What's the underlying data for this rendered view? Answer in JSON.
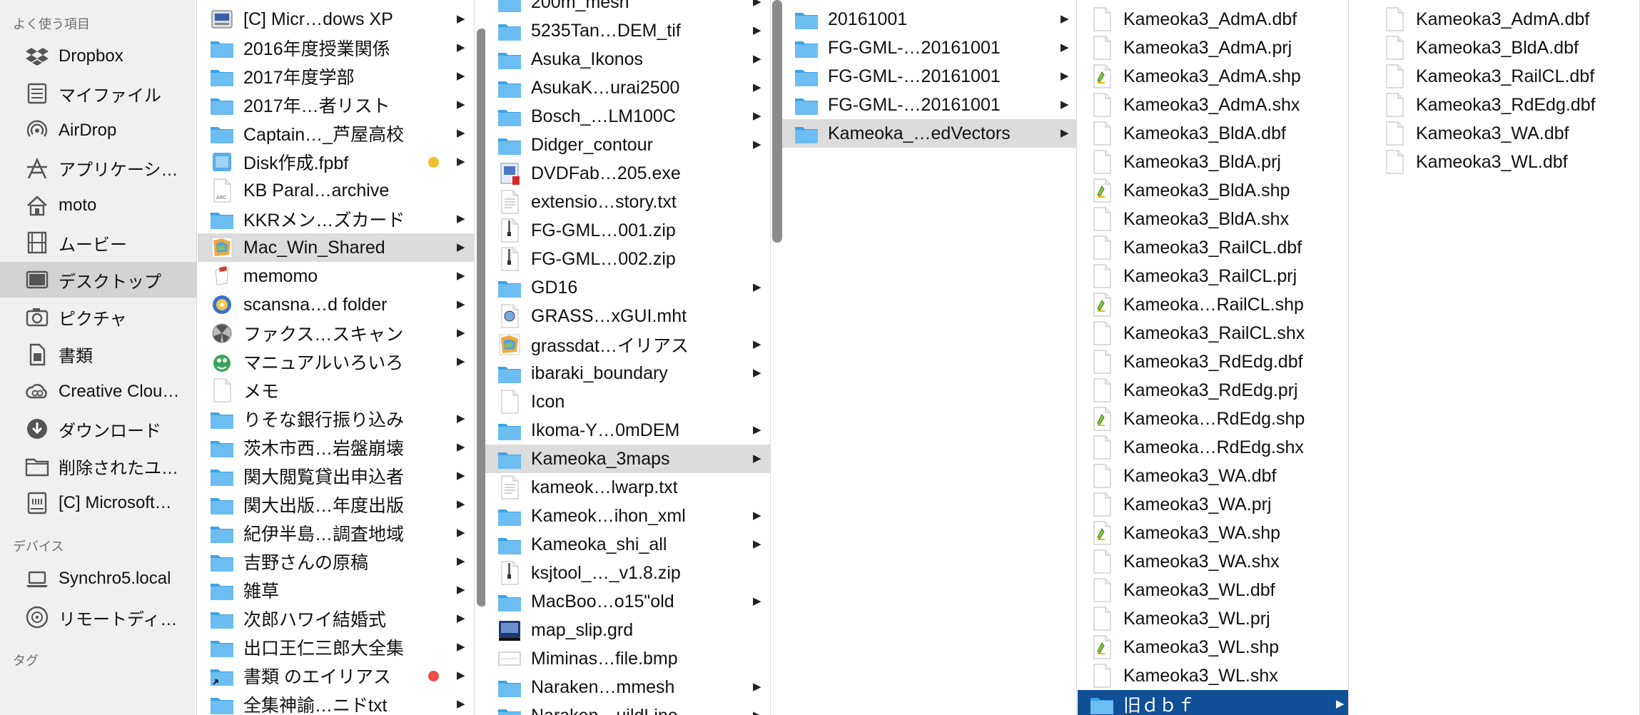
{
  "colors": {
    "folder": "#6cbdf2",
    "folder_dark": "#3ea2e6",
    "selection_active": "#114f96",
    "selection_inactive": "#dcdcdc",
    "tag_yellow": "#f2bf2d",
    "tag_red": "#ef4c46"
  },
  "sidebar": {
    "favorites_header": "よく使う項目",
    "favorites": [
      {
        "label": "Dropbox",
        "icon": "dropbox-icon"
      },
      {
        "label": "マイファイル",
        "icon": "all-my-files-icon"
      },
      {
        "label": "AirDrop",
        "icon": "airdrop-icon"
      },
      {
        "label": "アプリケーシ…",
        "icon": "applications-icon"
      },
      {
        "label": "moto",
        "icon": "home-icon"
      },
      {
        "label": "ムービー",
        "icon": "movies-icon"
      },
      {
        "label": "デスクトップ",
        "icon": "desktop-icon",
        "selected": true
      },
      {
        "label": "ピクチャ",
        "icon": "pictures-icon"
      },
      {
        "label": "書類",
        "icon": "documents-icon"
      },
      {
        "label": "Creative Clou…",
        "icon": "creative-cloud-icon"
      },
      {
        "label": "ダウンロード",
        "icon": "downloads-icon"
      },
      {
        "label": "削除されたユ…",
        "icon": "folder-icon"
      },
      {
        "label": "[C] Microsoft…",
        "icon": "drive-icon"
      }
    ],
    "devices_header": "デバイス",
    "devices": [
      {
        "label": "Synchro5.local",
        "icon": "laptop-icon"
      },
      {
        "label": "リモートディ…",
        "icon": "disc-icon"
      }
    ],
    "tags_header": "タグ"
  },
  "columns": [
    {
      "items": [
        {
          "name": "[C] Micr…dows XP",
          "icon": "drive",
          "arrow": true
        },
        {
          "name": "2016年度授業関係",
          "icon": "folder",
          "arrow": true
        },
        {
          "name": "2017年度学部",
          "icon": "folder",
          "arrow": true
        },
        {
          "name": "2017年…者リスト",
          "icon": "folder",
          "arrow": true
        },
        {
          "name": "Captain…_芦屋高校",
          "icon": "folder",
          "arrow": true
        },
        {
          "name": "Disk作成.fpbf",
          "icon": "bundle",
          "arrow": true,
          "tag": "yellow"
        },
        {
          "name": "KB Paral…archive",
          "icon": "archive",
          "arrow": false
        },
        {
          "name": "KKRメン…ズカード",
          "icon": "folder",
          "arrow": true
        },
        {
          "name": "Mac_Win_Shared",
          "icon": "alias",
          "arrow": true,
          "highlight": true
        },
        {
          "name": "memomo",
          "icon": "app",
          "arrow": true
        },
        {
          "name": "scansna…d folder",
          "icon": "app2",
          "arrow": true
        },
        {
          "name": "ファクス…スキャン",
          "icon": "app3",
          "arrow": true
        },
        {
          "name": "マニュアルいろいろ",
          "icon": "app4",
          "arrow": true
        },
        {
          "name": "メモ",
          "icon": "doc",
          "arrow": false
        },
        {
          "name": "りそな銀行振り込み",
          "icon": "folder",
          "arrow": true
        },
        {
          "name": "茨木市西…岩盤崩壊",
          "icon": "folder",
          "arrow": true
        },
        {
          "name": "関大閲覧貸出申込者",
          "icon": "folder",
          "arrow": true
        },
        {
          "name": "関大出版…年度出版",
          "icon": "folder",
          "arrow": true
        },
        {
          "name": "紀伊半島…調査地域",
          "icon": "folder",
          "arrow": true
        },
        {
          "name": "吉野さんの原稿",
          "icon": "folder",
          "arrow": true
        },
        {
          "name": "雑草",
          "icon": "folder",
          "arrow": true
        },
        {
          "name": "次郎ハワイ結婚式",
          "icon": "folder",
          "arrow": true
        },
        {
          "name": "出口王仁三郎大全集",
          "icon": "folder",
          "arrow": true
        },
        {
          "name": "書類 のエイリアス",
          "icon": "folder-alias",
          "arrow": true,
          "tag": "red"
        },
        {
          "name": "全集神諭…ニドtxt",
          "icon": "folder",
          "arrow": true
        }
      ]
    },
    {
      "items": [
        {
          "name": "200m_mesh",
          "icon": "folder",
          "arrow": true
        },
        {
          "name": "5235Tan…DEM_tif",
          "icon": "folder",
          "arrow": true
        },
        {
          "name": "Asuka_Ikonos",
          "icon": "folder",
          "arrow": true
        },
        {
          "name": "AsukaK…urai2500",
          "icon": "folder",
          "arrow": true
        },
        {
          "name": "Bosch_…LM100C",
          "icon": "folder",
          "arrow": true
        },
        {
          "name": "Didger_contour",
          "icon": "folder",
          "arrow": true
        },
        {
          "name": "DVDFab…205.exe",
          "icon": "exe",
          "arrow": false
        },
        {
          "name": "extensio…story.txt",
          "icon": "txt",
          "arrow": false
        },
        {
          "name": "FG-GML…001.zip",
          "icon": "zip",
          "arrow": false
        },
        {
          "name": "FG-GML…002.zip",
          "icon": "zip",
          "arrow": false
        },
        {
          "name": "GD16",
          "icon": "folder",
          "arrow": true
        },
        {
          "name": "GRASS…xGUI.mht",
          "icon": "mht",
          "arrow": false
        },
        {
          "name": "grassdat…イリアス",
          "icon": "alias",
          "arrow": true
        },
        {
          "name": "ibaraki_boundary",
          "icon": "folder",
          "arrow": true
        },
        {
          "name": "Icon",
          "icon": "doc",
          "arrow": false
        },
        {
          "name": "Ikoma-Y…0mDEM",
          "icon": "folder",
          "arrow": true
        },
        {
          "name": "Kameoka_3maps",
          "icon": "folder",
          "arrow": true,
          "highlight": true
        },
        {
          "name": "kameok…lwarp.txt",
          "icon": "txt",
          "arrow": false
        },
        {
          "name": "Kameok…ihon_xml",
          "icon": "folder",
          "arrow": true
        },
        {
          "name": "Kameoka_shi_all",
          "icon": "folder",
          "arrow": true
        },
        {
          "name": "ksjtool_…_v1.8.zip",
          "icon": "zip",
          "arrow": false
        },
        {
          "name": "MacBoo…o15\"old",
          "icon": "folder",
          "arrow": true
        },
        {
          "name": "map_slip.grd",
          "icon": "grd",
          "arrow": false
        },
        {
          "name": "Miminas…file.bmp",
          "icon": "bmp",
          "arrow": false
        },
        {
          "name": "Naraken…mmesh",
          "icon": "folder",
          "arrow": true
        },
        {
          "name": "Naraken…uildLine",
          "icon": "folder",
          "arrow": true
        }
      ]
    },
    {
      "items": [
        {
          "name": "20161001",
          "icon": "folder",
          "arrow": true
        },
        {
          "name": "FG-GML-…20161001",
          "icon": "folder",
          "arrow": true
        },
        {
          "name": "FG-GML-…20161001",
          "icon": "folder",
          "arrow": true
        },
        {
          "name": "FG-GML-…20161001",
          "icon": "folder",
          "arrow": true
        },
        {
          "name": "Kameoka_…edVectors",
          "icon": "folder",
          "arrow": true,
          "highlight": true
        }
      ]
    },
    {
      "items": [
        {
          "name": "Kameoka3_AdmA.dbf",
          "icon": "doc",
          "arrow": false
        },
        {
          "name": "Kameoka3_AdmA.prj",
          "icon": "doc",
          "arrow": false
        },
        {
          "name": "Kameoka3_AdmA.shp",
          "icon": "shp",
          "arrow": false
        },
        {
          "name": "Kameoka3_AdmA.shx",
          "icon": "doc",
          "arrow": false
        },
        {
          "name": "Kameoka3_BldA.dbf",
          "icon": "doc",
          "arrow": false
        },
        {
          "name": "Kameoka3_BldA.prj",
          "icon": "doc",
          "arrow": false
        },
        {
          "name": "Kameoka3_BldA.shp",
          "icon": "shp",
          "arrow": false
        },
        {
          "name": "Kameoka3_BldA.shx",
          "icon": "doc",
          "arrow": false
        },
        {
          "name": "Kameoka3_RailCL.dbf",
          "icon": "doc",
          "arrow": false
        },
        {
          "name": "Kameoka3_RailCL.prj",
          "icon": "doc",
          "arrow": false
        },
        {
          "name": "Kameoka…RailCL.shp",
          "icon": "shp",
          "arrow": false
        },
        {
          "name": "Kameoka3_RailCL.shx",
          "icon": "doc",
          "arrow": false
        },
        {
          "name": "Kameoka3_RdEdg.dbf",
          "icon": "doc",
          "arrow": false
        },
        {
          "name": "Kameoka3_RdEdg.prj",
          "icon": "doc",
          "arrow": false
        },
        {
          "name": "Kameoka…RdEdg.shp",
          "icon": "shp",
          "arrow": false
        },
        {
          "name": "Kameoka…RdEdg.shx",
          "icon": "doc",
          "arrow": false
        },
        {
          "name": "Kameoka3_WA.dbf",
          "icon": "doc",
          "arrow": false
        },
        {
          "name": "Kameoka3_WA.prj",
          "icon": "doc",
          "arrow": false
        },
        {
          "name": "Kameoka3_WA.shp",
          "icon": "shp",
          "arrow": false
        },
        {
          "name": "Kameoka3_WA.shx",
          "icon": "doc",
          "arrow": false
        },
        {
          "name": "Kameoka3_WL.dbf",
          "icon": "doc",
          "arrow": false
        },
        {
          "name": "Kameoka3_WL.prj",
          "icon": "doc",
          "arrow": false
        },
        {
          "name": "Kameoka3_WL.shp",
          "icon": "shp",
          "arrow": false
        },
        {
          "name": "Kameoka3_WL.shx",
          "icon": "doc",
          "arrow": false
        },
        {
          "name": "旧ｄｂｆ",
          "icon": "folder",
          "arrow": true,
          "selected": true
        }
      ]
    },
    {
      "items": [
        {
          "name": "Kameoka3_AdmA.dbf",
          "icon": "doc",
          "arrow": false
        },
        {
          "name": "Kameoka3_BldA.dbf",
          "icon": "doc",
          "arrow": false
        },
        {
          "name": "Kameoka3_RailCL.dbf",
          "icon": "doc",
          "arrow": false
        },
        {
          "name": "Kameoka3_RdEdg.dbf",
          "icon": "doc",
          "arrow": false
        },
        {
          "name": "Kameoka3_WA.dbf",
          "icon": "doc",
          "arrow": false
        },
        {
          "name": "Kameoka3_WL.dbf",
          "icon": "doc",
          "arrow": false
        }
      ]
    }
  ]
}
